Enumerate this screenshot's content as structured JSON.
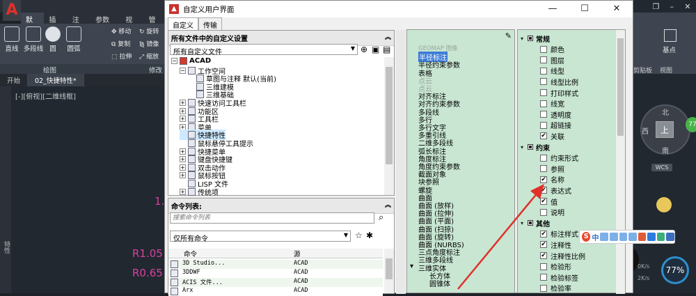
{
  "cad": {
    "logo": "A",
    "ribbon_tabs": [
      "默认",
      "插入",
      "注释",
      "参数化",
      "视图",
      "管理"
    ],
    "tools": {
      "line": "直线",
      "polyline": "多段线",
      "circle": "圆",
      "arc": "圆弧",
      "move": "移动",
      "rotate": "旋转",
      "copy": "复制",
      "mirror": "镜像",
      "stretch": "拉伸",
      "scale": "缩放"
    },
    "panel_draw": "绘图",
    "panel_modify": "修改",
    "doc_tabs": [
      "开始",
      "02_快捷特性*"
    ],
    "view_label": "[-][俯视][二维线框]",
    "sidebar_label": "特性",
    "dims": [
      "R1.05",
      "R0.65",
      "1.5"
    ],
    "right_ribbon": {
      "base": "基点",
      "clipboard": "剪贴板",
      "view": "视图"
    },
    "compass": {
      "north": "北",
      "west": "西",
      "south": "南",
      "center": "上",
      "wcs": "WCS"
    },
    "speed": {
      "percent": "77%",
      "up": "0K/s",
      "down": "2K/s"
    },
    "green_badge": "77"
  },
  "dialog": {
    "title": "自定义用户界面",
    "tabs": [
      "自定义",
      "传输"
    ],
    "customize_panel": {
      "heading": "所有文件中的自定义设置",
      "file_select": "所有自定义文件",
      "tree": [
        {
          "label": "ACAD",
          "level": 0,
          "exp": "−"
        },
        {
          "label": "工作空间",
          "level": 1,
          "exp": "−"
        },
        {
          "label": "草图与注释 默认(当前)",
          "level": 2,
          "exp": ""
        },
        {
          "label": "三维建模",
          "level": 2,
          "exp": ""
        },
        {
          "label": "三维基础",
          "level": 2,
          "exp": ""
        },
        {
          "label": "快速访问工具栏",
          "level": 1,
          "exp": "+"
        },
        {
          "label": "功能区",
          "level": 1,
          "exp": "+"
        },
        {
          "label": "工具栏",
          "level": 1,
          "exp": "+"
        },
        {
          "label": "菜单",
          "level": 1,
          "exp": "+"
        },
        {
          "label": "快捷特性",
          "level": 1,
          "exp": ""
        },
        {
          "label": "鼠标悬停工具提示",
          "level": 1,
          "exp": ""
        },
        {
          "label": "快捷菜单",
          "level": 1,
          "exp": "+"
        },
        {
          "label": "键盘快捷键",
          "level": 1,
          "exp": "+"
        },
        {
          "label": "双击动作",
          "level": 1,
          "exp": "+"
        },
        {
          "label": "鼠标按钮",
          "level": 1,
          "exp": "+"
        },
        {
          "label": "LISP 文件",
          "level": 1,
          "exp": ""
        },
        {
          "label": "传统项",
          "level": 1,
          "exp": "+"
        }
      ]
    },
    "command_panel": {
      "heading": "命令列表:",
      "search_placeholder": "搜索命令列表",
      "filter": "仅所有命令",
      "columns": [
        "命令",
        "源"
      ],
      "rows": [
        {
          "cmd": "3D Studio...",
          "src": "ACAD"
        },
        {
          "cmd": "3DDWF",
          "src": "ACAD"
        },
        {
          "cmd": "ACIS 文件...",
          "src": "ACAD"
        },
        {
          "cmd": "Arx",
          "src": "ACAD"
        }
      ]
    },
    "object_types": [
      {
        "label": "GEOMAP 图像",
        "grey": true
      },
      {
        "label": "半径标注",
        "hl": true
      },
      {
        "label": "半径约束参数"
      },
      {
        "label": "表格"
      },
      {
        "label": "点云",
        "grey": true
      },
      {
        "label": "点云",
        "grey": true
      },
      {
        "label": "对齐标注"
      },
      {
        "label": "对齐约束参数"
      },
      {
        "label": "多段线"
      },
      {
        "label": "多行"
      },
      {
        "label": "多行文字"
      },
      {
        "label": "多重引线"
      },
      {
        "label": "二维多段线"
      },
      {
        "label": "弧长标注"
      },
      {
        "label": "角度标注"
      },
      {
        "label": "角度约束参数"
      },
      {
        "label": "截面对象"
      },
      {
        "label": "块参照"
      },
      {
        "label": "螺旋"
      },
      {
        "label": "曲面"
      },
      {
        "label": "曲面 (放样)"
      },
      {
        "label": "曲面 (拉伸)"
      },
      {
        "label": "曲面 (平面)"
      },
      {
        "label": "曲面 (扫掠)"
      },
      {
        "label": "曲面 (旋转)"
      },
      {
        "label": "曲面 (NURBS)"
      },
      {
        "label": "三点角度标注"
      },
      {
        "label": "三维多段线"
      },
      {
        "label": "三维实体",
        "exp": true
      },
      {
        "label": "长方体",
        "indent": true
      },
      {
        "label": "圆锥体",
        "indent": true
      }
    ],
    "properties": [
      {
        "label": "常规",
        "group": true
      },
      {
        "label": "颜色",
        "checked": false
      },
      {
        "label": "图层",
        "checked": false
      },
      {
        "label": "线型",
        "checked": false
      },
      {
        "label": "线型比例",
        "checked": false
      },
      {
        "label": "打印样式",
        "checked": false
      },
      {
        "label": "线宽",
        "checked": false
      },
      {
        "label": "透明度",
        "checked": false
      },
      {
        "label": "超链接",
        "checked": false
      },
      {
        "label": "关联",
        "checked": true
      },
      {
        "label": "约束",
        "group": true
      },
      {
        "label": "约束形式",
        "checked": false
      },
      {
        "label": "参照",
        "checked": false
      },
      {
        "label": "名称",
        "checked": true
      },
      {
        "label": "表达式",
        "checked": true
      },
      {
        "label": "值",
        "checked": true
      },
      {
        "label": "说明",
        "checked": false
      },
      {
        "label": "其他",
        "group": true
      },
      {
        "label": "标注样式",
        "checked": true
      },
      {
        "label": "注释性",
        "checked": true
      },
      {
        "label": "注释性比例",
        "checked": true
      },
      {
        "label": "检验形",
        "checked": false
      },
      {
        "label": "检验标签",
        "checked": false
      },
      {
        "label": "检验率",
        "checked": false
      }
    ]
  },
  "sogou": {
    "logo": "S",
    "lang": "中"
  },
  "colors": {
    "accent_red": "#e0302a",
    "list_green": "#c8e6d2",
    "highlight_blue": "#3d7bd6",
    "dim_magenta": "#d9409f"
  }
}
